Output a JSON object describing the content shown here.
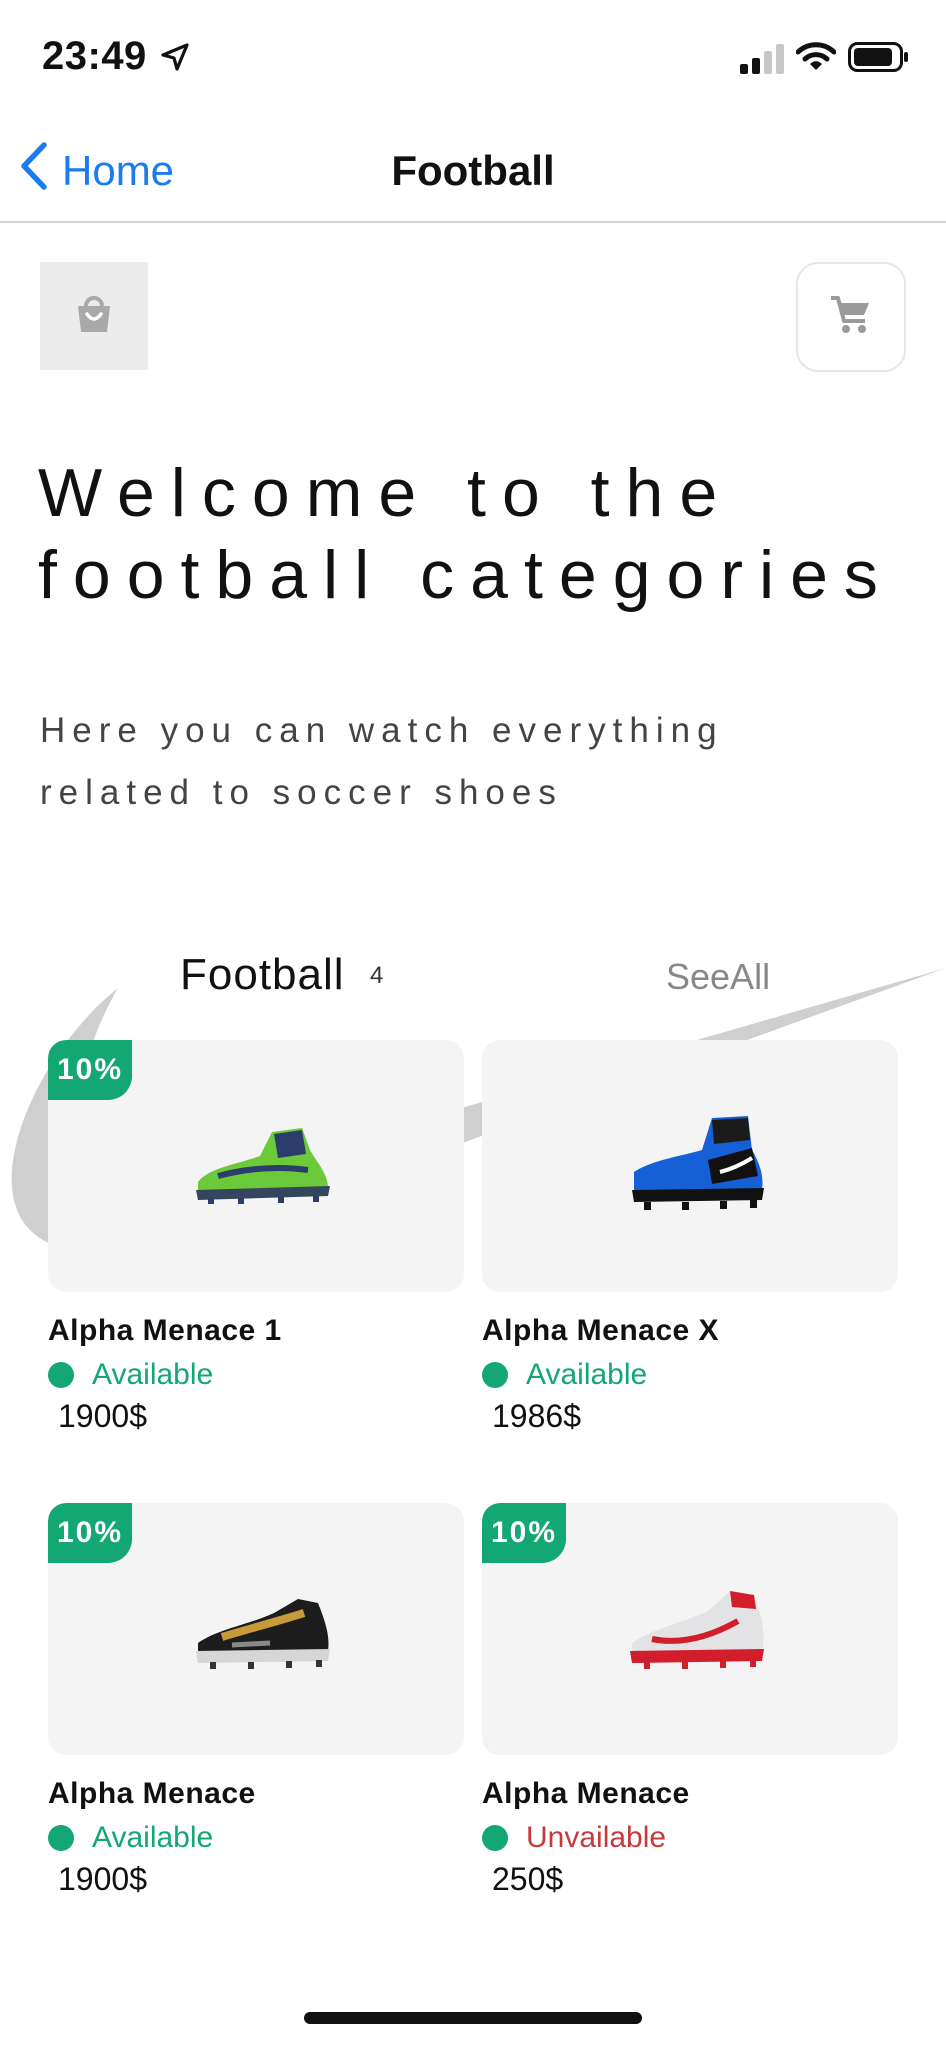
{
  "status_bar": {
    "time": "23:49"
  },
  "nav": {
    "back_label": "Home",
    "title": "Football"
  },
  "welcome": {
    "title": "Welcome to the football categories",
    "subtitle": "Here you can watch everything related to soccer shoes"
  },
  "section": {
    "title": "Football",
    "count": "4",
    "see_all": "SeeAll"
  },
  "colors": {
    "accent_green": "#13a774",
    "unavailable_red": "#c8393b",
    "ios_blue": "#1a7cf0"
  },
  "products": [
    {
      "name": "Alpha Menace 1",
      "status": "Available",
      "price": "1900$",
      "discount": "10%",
      "shoe": "green-cleat"
    },
    {
      "name": "Alpha Menace X",
      "status": "Available",
      "price": "1986$",
      "discount": "",
      "shoe": "blue-high-cleat"
    },
    {
      "name": "Alpha Menace",
      "status": "Available",
      "price": "1900$",
      "discount": "10%",
      "shoe": "black-gold-cleat"
    },
    {
      "name": "Alpha Menace",
      "status": "Unvailable",
      "price": "250$",
      "discount": "10%",
      "shoe": "white-red-cleat"
    }
  ]
}
